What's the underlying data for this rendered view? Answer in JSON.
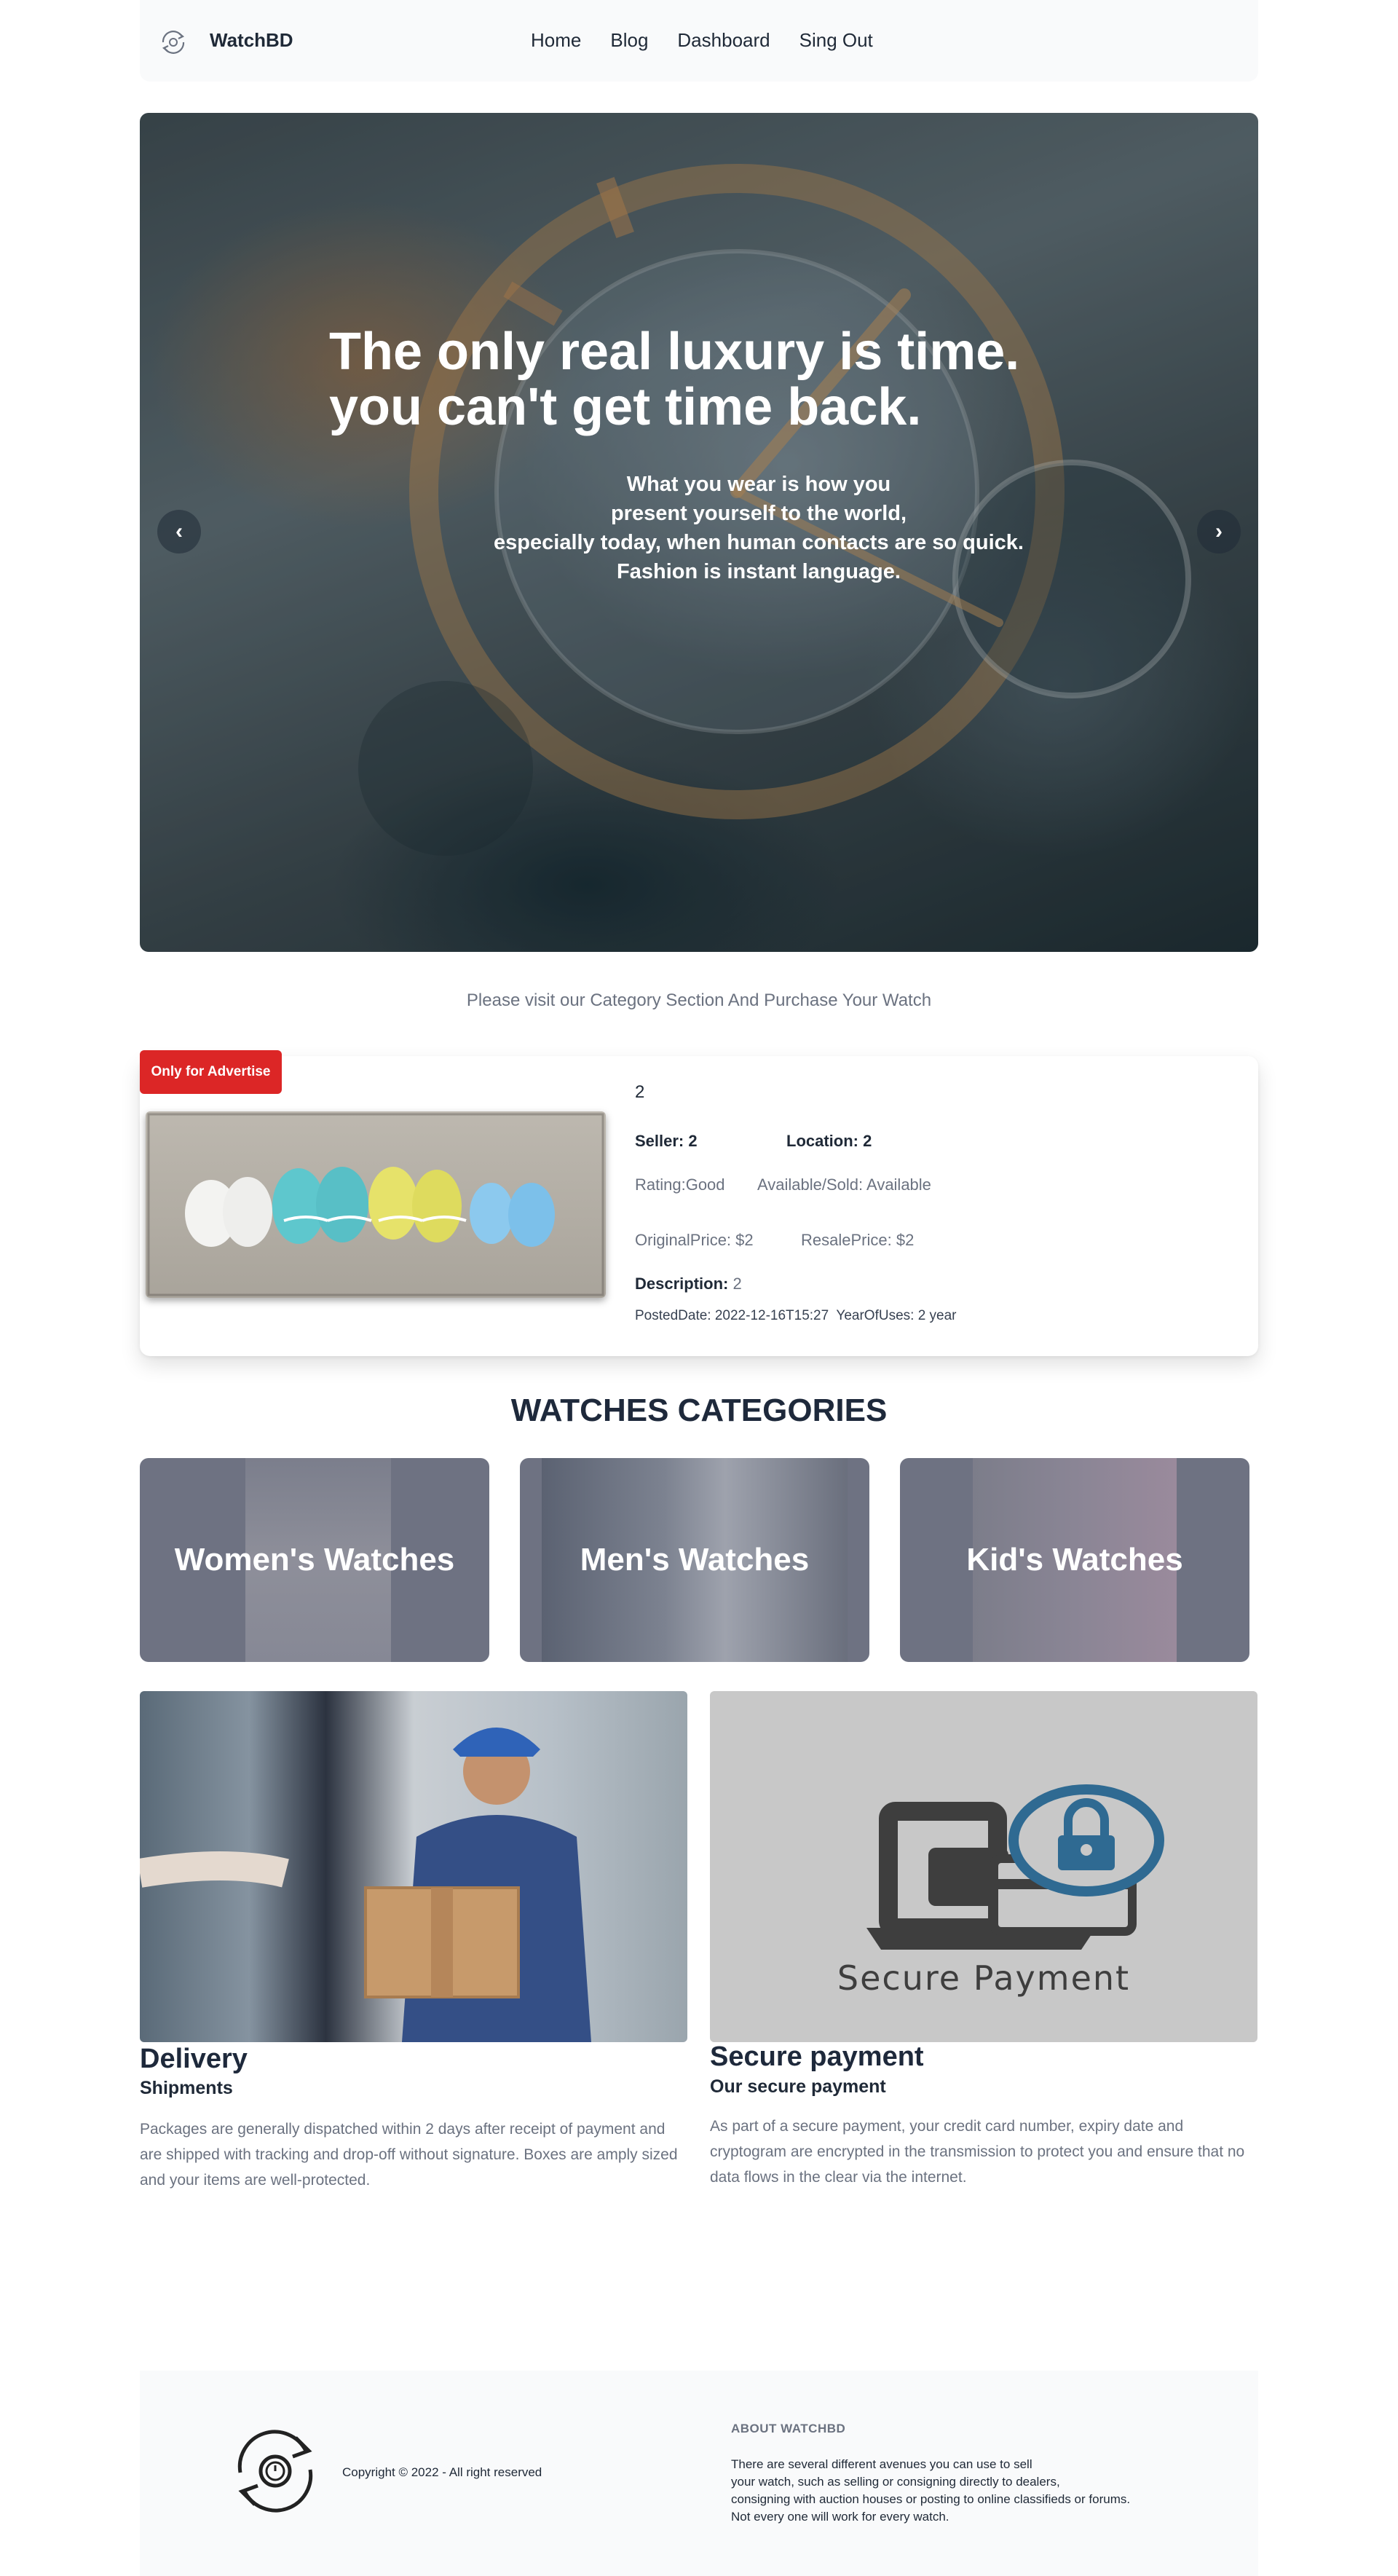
{
  "nav": {
    "brand": "WatchBD",
    "logo_icon": "watch-exchange-icon",
    "links": [
      "Home",
      "Blog",
      "Dashboard",
      "Sing Out"
    ]
  },
  "hero": {
    "title_line1": "The only real luxury is time.",
    "title_line2": "you can't get time back.",
    "sub_line1": "What you wear is how you",
    "sub_line2": "present yourself to the world,",
    "sub_line3": "especially today, when human contacts are so quick.",
    "sub_line4": "Fashion is instant language.",
    "prev": "‹",
    "next": "›"
  },
  "visit_text": "Please visit our Category Section And Purchase Your Watch",
  "advertise": {
    "badge": "Only for Advertise",
    "title": "2",
    "seller_label": "Seller:",
    "seller": "2",
    "location_label": "Location:",
    "location": "2",
    "rating": "Rating:Good",
    "available": "Available/Sold: Available",
    "original_price": "OriginalPrice: $2",
    "resale_price": "ResalePrice: $2",
    "description_label": "Description:",
    "description": "2",
    "posted": "PostedDate: 2022-12-16T15:27",
    "year_of_use": "YearOfUses: 2 year"
  },
  "categories": {
    "heading": "WATCHES CATEGORIES",
    "items": [
      "Women's Watches",
      "Men's Watches",
      "Kid's Watches"
    ]
  },
  "features": {
    "delivery": {
      "title": "Delivery",
      "subtitle": "Shipments",
      "text": "Packages are generally dispatched within 2 days after receipt of payment and are shipped with tracking and drop-off without signature. Boxes are amply sized and your items are well-protected."
    },
    "payment": {
      "title": "Secure payment",
      "subtitle": "Our secure payment",
      "image_text": "Secure Payment",
      "text": "As part of a secure payment, your credit card number, expiry date and cryptogram are encrypted in the transmission to protect you and ensure that no data flows in the clear via the internet."
    }
  },
  "footer": {
    "copyright": "Copyright © 2022 - All right reserved",
    "about_heading": "ABOUT WATCHBD",
    "about_line1": "There are several different avenues you can use to sell",
    "about_line2": "your watch, such as selling or consigning directly to dealers,",
    "about_line3": "consigning with auction houses or posting to online classifieds or forums.",
    "about_line4": "Not every one will work for every watch."
  },
  "colors": {
    "accent_red": "#dc2626",
    "heading": "#1e293b",
    "muted": "#6b7280",
    "lock_blue": "#2f6a92"
  }
}
